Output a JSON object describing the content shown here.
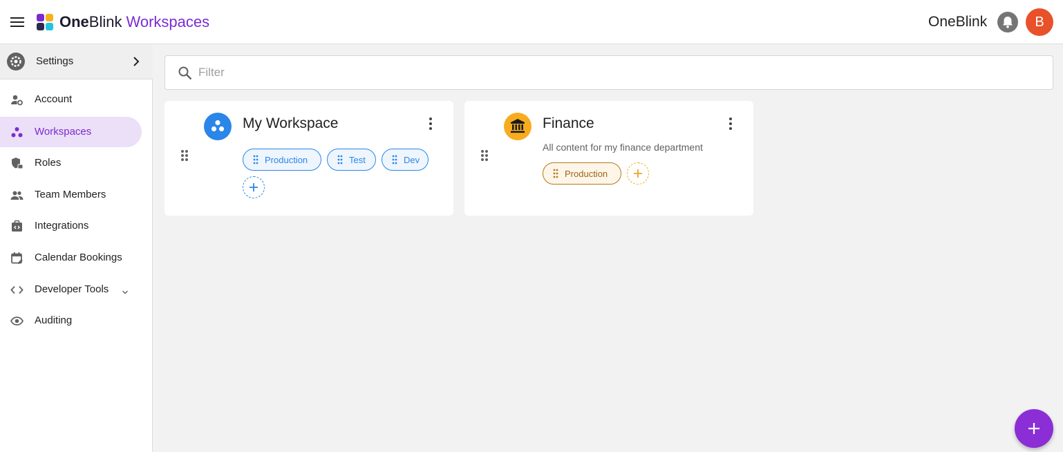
{
  "header": {
    "brand_bold": "One",
    "brand_regular": "Blink",
    "brand_accent": "Workspaces",
    "org_name": "OneBlink",
    "avatar_initial": "B",
    "icons": {
      "menu": "hamburger-menu-icon",
      "notifications": "bell-icon"
    }
  },
  "colors": {
    "accent": "#7b2cd0",
    "active_bg": "#ecdff8",
    "avatar": "#e8512a",
    "fab": "#8b2ed6",
    "workspace_blue": "#2a86e8",
    "finance_gold": "#f7ac20",
    "finance_chip": "#b5781a"
  },
  "sidebar": {
    "section": {
      "label": "Settings",
      "icon": "gear-icon"
    },
    "items": [
      {
        "label": "Account",
        "icon": "account-cog-icon"
      },
      {
        "label": "Workspaces",
        "icon": "workspaces-icon",
        "active": true
      },
      {
        "label": "Roles",
        "icon": "shield-lock-icon"
      },
      {
        "label": "Team Members",
        "icon": "people-icon"
      },
      {
        "label": "Integrations",
        "icon": "integrations-icon"
      },
      {
        "label": "Calendar Bookings",
        "icon": "calendar-edit-icon"
      },
      {
        "label": "Developer Tools",
        "icon": "code-icon",
        "expandable": true
      },
      {
        "label": "Auditing",
        "icon": "eye-icon"
      }
    ]
  },
  "filter": {
    "placeholder": "Filter",
    "value": ""
  },
  "workspaces": [
    {
      "name": "My Workspace",
      "description": "",
      "icon": "workspace-icon",
      "environments": [
        "Production",
        "Test",
        "Dev"
      ]
    },
    {
      "name": "Finance",
      "description": "All content for my finance department",
      "icon": "bank-icon",
      "environments": [
        "Production"
      ]
    }
  ],
  "fab": {
    "icon": "plus-icon"
  }
}
